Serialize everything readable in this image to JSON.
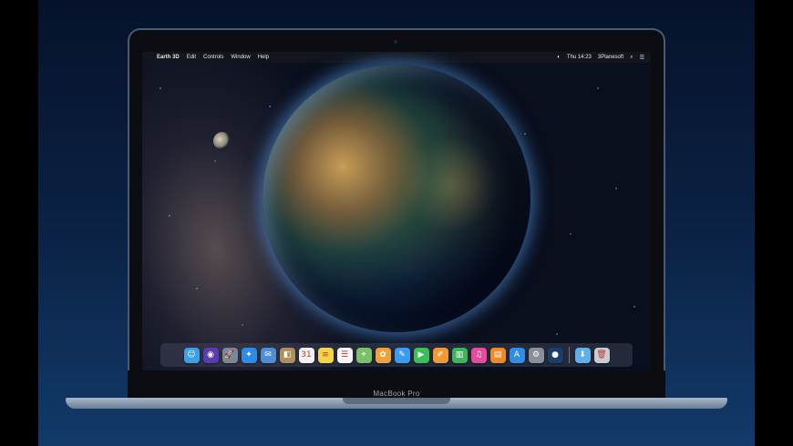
{
  "menubar": {
    "apple": "",
    "app_name": "Earth 3D",
    "menus": [
      "Edit",
      "Controls",
      "Window",
      "Help"
    ],
    "clock": "Thu 14:23",
    "user": "3Planesoft"
  },
  "dock": {
    "apps": [
      {
        "name": "finder",
        "glyph": "☺",
        "color": "#3aa0e8"
      },
      {
        "name": "siri",
        "glyph": "◉",
        "color": "#5b3bb0"
      },
      {
        "name": "launchpad",
        "glyph": "🚀",
        "color": "#7a8798"
      },
      {
        "name": "safari",
        "glyph": "✦",
        "color": "#2e8be6"
      },
      {
        "name": "mail",
        "glyph": "✉",
        "color": "#4b8fd6"
      },
      {
        "name": "contacts",
        "glyph": "◧",
        "color": "#b08f5a"
      },
      {
        "name": "calendar",
        "glyph": "31",
        "color": "#f2f2f2"
      },
      {
        "name": "notes",
        "glyph": "≡",
        "color": "#f3d34a"
      },
      {
        "name": "reminders",
        "glyph": "☰",
        "color": "#f4f4f4"
      },
      {
        "name": "maps",
        "glyph": "⌖",
        "color": "#7cc06a"
      },
      {
        "name": "photos",
        "glyph": "✿",
        "color": "#f0a13a"
      },
      {
        "name": "messages",
        "glyph": "✎",
        "color": "#3a9cf0"
      },
      {
        "name": "facetime",
        "glyph": "▶",
        "color": "#3bbf56"
      },
      {
        "name": "pages",
        "glyph": "✐",
        "color": "#f09a33"
      },
      {
        "name": "numbers",
        "glyph": "▥",
        "color": "#3fb35a"
      },
      {
        "name": "itunes",
        "glyph": "♫",
        "color": "#e94a9b"
      },
      {
        "name": "ibooks",
        "glyph": "▤",
        "color": "#f08a23"
      },
      {
        "name": "app-store",
        "glyph": "A",
        "color": "#2f8ce8"
      },
      {
        "name": "system-preferences",
        "glyph": "⚙",
        "color": "#8a8f98"
      },
      {
        "name": "earth-3d",
        "glyph": "●",
        "color": "#1d3d6b"
      }
    ],
    "extras": [
      {
        "name": "downloads-folder",
        "glyph": "⬇",
        "color": "#5fb0e8"
      },
      {
        "name": "trash",
        "glyph": "🗑",
        "color": "#c8ccd2"
      }
    ]
  },
  "device_label": "MacBook Pro"
}
